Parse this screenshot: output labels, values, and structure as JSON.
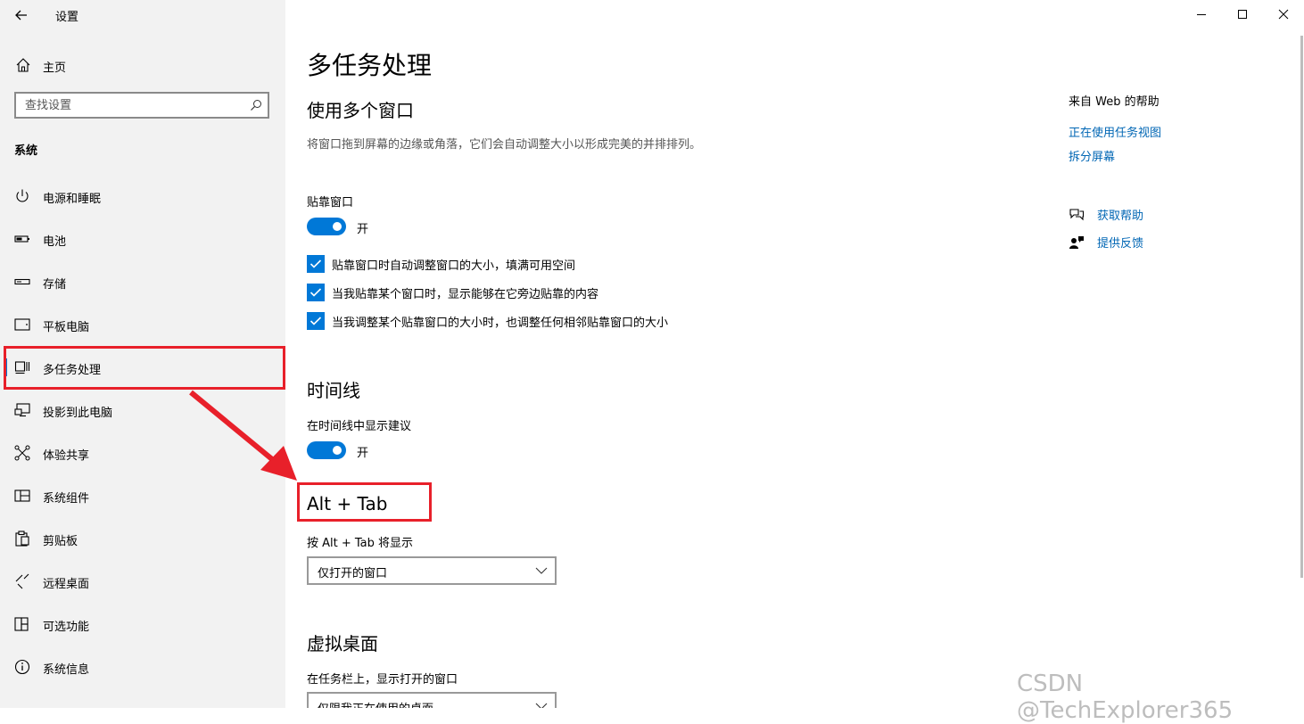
{
  "window": {
    "title": "设置",
    "controls": [
      "minimize-icon",
      "maximize-icon",
      "close-icon"
    ]
  },
  "sidebar": {
    "home_label": "主页",
    "search_placeholder": "查找设置",
    "section": "系统",
    "items": [
      {
        "label": "电源和睡眠",
        "icon": "power-icon"
      },
      {
        "label": "电池",
        "icon": "battery-icon"
      },
      {
        "label": "存储",
        "icon": "storage-icon"
      },
      {
        "label": "平板电脑",
        "icon": "tablet-icon"
      },
      {
        "label": "多任务处理",
        "icon": "multitasking-icon",
        "selected": true
      },
      {
        "label": "投影到此电脑",
        "icon": "project-icon"
      },
      {
        "label": "体验共享",
        "icon": "share-icon"
      },
      {
        "label": "系统组件",
        "icon": "components-icon"
      },
      {
        "label": "剪贴板",
        "icon": "clipboard-icon"
      },
      {
        "label": "远程桌面",
        "icon": "remote-desktop-icon"
      },
      {
        "label": "可选功能",
        "icon": "optional-features-icon"
      },
      {
        "label": "系统信息",
        "icon": "info-icon"
      }
    ]
  },
  "main": {
    "title": "多任务处理",
    "windows_section": {
      "heading": "使用多个窗口",
      "description": "将窗口拖到屏幕的边缘或角落，它们会自动调整大小以形成完美的并排排列。",
      "snap_label": "贴靠窗口",
      "snap_toggle": "开",
      "checkboxes": [
        {
          "label": "贴靠窗口时自动调整窗口的大小，填满可用空间",
          "checked": true
        },
        {
          "label": "当我贴靠某个窗口时，显示能够在它旁边贴靠的内容",
          "checked": true
        },
        {
          "label": "当我调整某个贴靠窗口的大小时，也调整任何相邻贴靠窗口的大小",
          "checked": true
        }
      ]
    },
    "timeline_section": {
      "heading": "时间线",
      "label": "在时间线中显示建议",
      "toggle": "开"
    },
    "alttab_section": {
      "heading": "Alt + Tab",
      "label": "按 Alt + Tab 将显示",
      "selected": "仅打开的窗口"
    },
    "virtual_desktop_section": {
      "heading": "虚拟桌面",
      "label": "在任务栏上，显示打开的窗口",
      "selected": "仅限我正在使用的桌面"
    }
  },
  "help": {
    "heading": "来自 Web 的帮助",
    "links": [
      "正在使用任务视图",
      "拆分屏幕"
    ],
    "get_help": "获取帮助",
    "feedback": "提供反馈"
  },
  "watermark": "CSDN @TechExplorer365",
  "colors": {
    "accent": "#0078d7",
    "link": "#0066b4",
    "annotation_red": "#e8202a",
    "sidebar_bg": "#f2f2f2"
  }
}
